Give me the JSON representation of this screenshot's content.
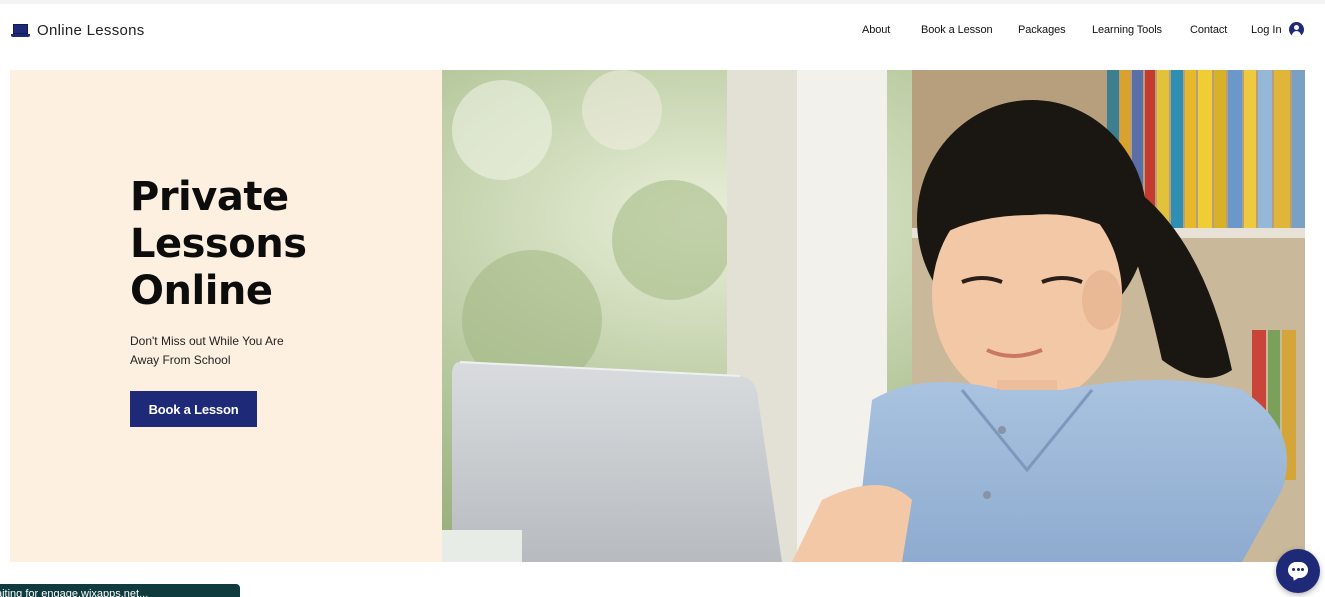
{
  "header": {
    "logo_text": "Online Lessons",
    "logo_icon": "laptop-icon",
    "nav": [
      {
        "label": "About"
      },
      {
        "label": "Book a Lesson"
      },
      {
        "label": "Packages"
      },
      {
        "label": "Learning Tools"
      },
      {
        "label": "Contact"
      }
    ],
    "login_label": "Log In",
    "login_icon": "user-avatar-icon"
  },
  "hero": {
    "title": "Private Lessons Online",
    "subtitle": "Don't Miss out While You Are Away From School",
    "cta_label": "Book a Lesson",
    "image_description_icon": "student-photo"
  },
  "chat": {
    "icon": "chat-bubble-icon"
  },
  "status_bar": {
    "text": "aiting for engage.wixapps.net..."
  },
  "colors": {
    "brand_navy": "#1e2a78",
    "hero_left_bg": "#fdf0e1",
    "status_bar_bg": "#0f3a3e"
  }
}
